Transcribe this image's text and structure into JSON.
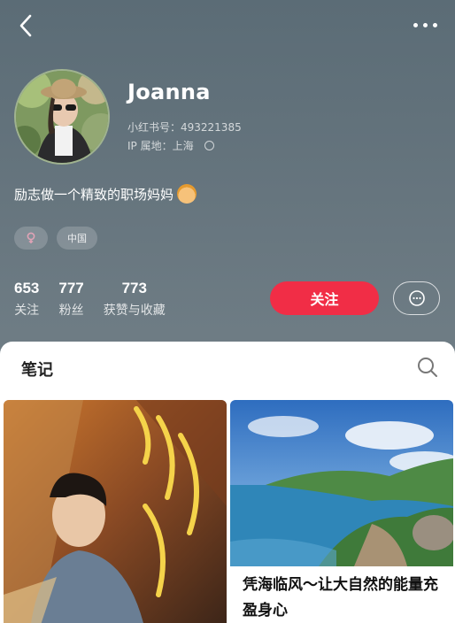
{
  "profile": {
    "username": "Joanna",
    "id_text": "小红书号：493221385",
    "ip_label": "IP 属地：上海",
    "bio": "励志做一个精致的职场妈妈",
    "tags": [
      "中国"
    ],
    "stats": [
      {
        "value": "653",
        "label": "关注"
      },
      {
        "value": "777",
        "label": "粉丝"
      },
      {
        "value": "773",
        "label": "获赞与收藏"
      }
    ],
    "follow_label": "关注"
  },
  "notes": {
    "tab_label": "笔记",
    "cards": [
      {
        "title": ""
      },
      {
        "title": "凭海临风～让大自然的能量充盈身心"
      }
    ]
  },
  "colors": {
    "header_bg": "#5f6f78",
    "accent": "#f12d46",
    "panel_bg": "#ffffff"
  },
  "icons": {
    "back": "chevron-left-icon",
    "more": "more-dots-icon",
    "info": "info-circle-icon",
    "gender": "gender-icon",
    "message": "chat-bubble-icon",
    "search": "search-icon"
  }
}
